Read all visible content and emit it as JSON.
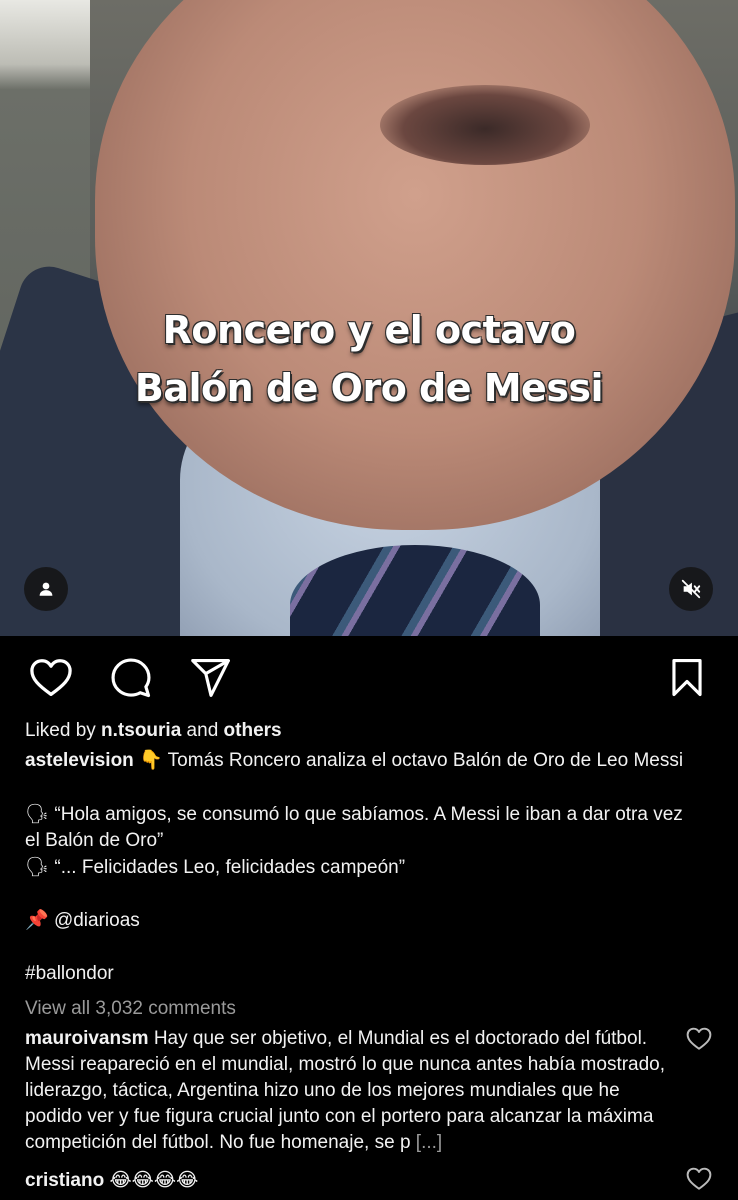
{
  "video": {
    "title_line1": "Roncero y el octavo",
    "title_line2": "Balón de Oro de Messi",
    "user_icon": "person-icon",
    "mute_icon": "speaker-muted-icon"
  },
  "actions": {
    "like_icon": "heart-icon",
    "comment_icon": "comment-bubble-icon",
    "share_icon": "paper-plane-icon",
    "save_icon": "bookmark-icon"
  },
  "likes": {
    "prefix": "Liked by ",
    "user": "n.tsouria",
    "middle": " and ",
    "others": "others"
  },
  "caption": {
    "username": "astelevision",
    "emoji": "👇",
    "text": " Tomás Roncero analiza el octavo Balón de Oro de Leo Messi",
    "quote1_emoji": "🗣",
    "quote1_a": " “Hola amigos, se consumó lo que sabíamos. A Messi le iban a dar otra vez",
    "quote1_b": "el Balón de Oro”",
    "quote2_emoji": "🗣",
    "quote2": " “... Felicidades Leo, felicidades campeón”",
    "pin_emoji": "📌",
    "mention": " @diarioas",
    "hashtag": "#ballondor"
  },
  "view_all": "View all 3,032 comments",
  "comments": [
    {
      "username": "mauroivansm",
      "text": " Hay que ser objetivo, el Mundial es el doctorado del fútbol. Messi reapareció en el mundial, mostró lo que nunca antes había mostrado, liderazgo, táctica, Argentina hizo uno de los mejores mundiales que he podido ver y fue figura crucial junto con el portero para alcanzar la máxima competición del fútbol. No fue homenaje, se p ",
      "more": "[...]"
    },
    {
      "username": "cristiano",
      "text": " 😂😂😂😂"
    }
  ]
}
